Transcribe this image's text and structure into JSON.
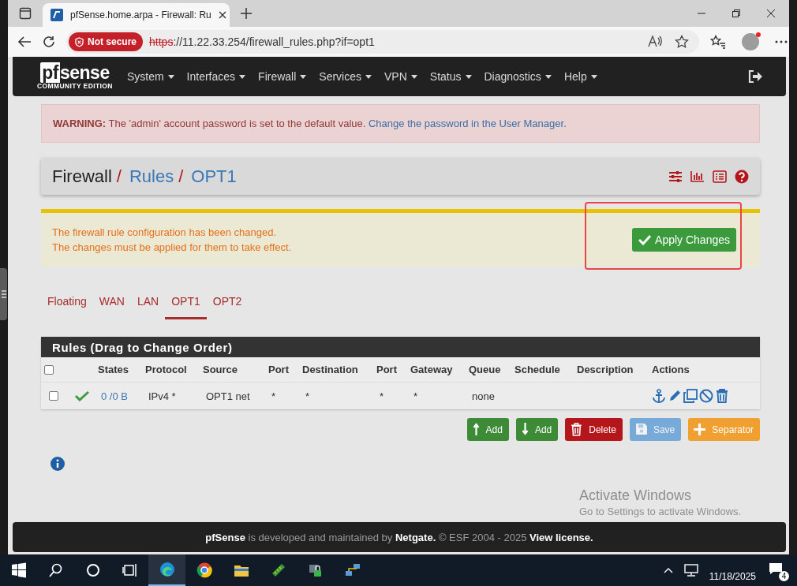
{
  "browser": {
    "tab_title": "pfSense.home.arpa - Firewall: Ru",
    "security_label": "Not secure",
    "url_scheme": "https",
    "url_rest": "://11.22.33.254/firewall_rules.php?if=opt1"
  },
  "navbar": {
    "logo_parts": [
      "pf",
      "sense"
    ],
    "logo_edition": "COMMUNITY EDITION",
    "menu": [
      "System",
      "Interfaces",
      "Firewall",
      "Services",
      "VPN",
      "Status",
      "Diagnostics",
      "Help"
    ]
  },
  "warning": {
    "label": "WARNING:",
    "message": "The 'admin' account password is set to the default value.",
    "link": "Change the password in the User Manager."
  },
  "breadcrumb": [
    {
      "label": "Firewall",
      "link": false,
      "separator": "/"
    },
    {
      "label": "Rules",
      "link": true,
      "separator": "/"
    },
    {
      "label": "OPT1",
      "link": true
    }
  ],
  "alert": {
    "lines": [
      "The firewall rule configuration has been changed.",
      "The changes must be applied for them to take effect."
    ],
    "button": "Apply Changes"
  },
  "interface_tabs": [
    {
      "label": "Floating",
      "selected": false
    },
    {
      "label": "WAN",
      "selected": false
    },
    {
      "label": "LAN",
      "selected": false
    },
    {
      "label": "OPT1",
      "selected": true
    },
    {
      "label": "OPT2",
      "selected": false
    }
  ],
  "rules": {
    "title": "Rules (Drag to Change Order)",
    "select_all_checked": false,
    "columns": [
      "States",
      "Protocol",
      "Source",
      "Port",
      "Destination",
      "Port",
      "Gateway",
      "Queue",
      "Schedule",
      "Description",
      "Actions"
    ],
    "rows": [
      {
        "checked": false,
        "enabled": true,
        "states": "0 /0 B",
        "protocol": "IPv4 *",
        "source": "OPT1 net",
        "source_port": "*",
        "destination": "*",
        "destination_port": "*",
        "gateway": "*",
        "queue": "none"
      }
    ]
  },
  "buttons": [
    {
      "kind": "add_top",
      "label": "Add",
      "disabled": false
    },
    {
      "kind": "add_bottom",
      "label": "Add",
      "disabled": false
    },
    {
      "kind": "delete",
      "label": "Delete",
      "disabled": false
    },
    {
      "kind": "save",
      "label": "Save",
      "disabled": true
    },
    {
      "kind": "separator",
      "label": "Separator",
      "disabled": false
    }
  ],
  "footer": {
    "text": "**pfSense** is developed and maintained by **Netgate.** © ESF 2004 - 2025",
    "link": "View license."
  },
  "activation": {
    "title": "Activate Windows",
    "subtitle": "Go to Settings to activate Windows."
  },
  "taskbar": {
    "date": "11/18/2025",
    "notification_count": "4"
  }
}
